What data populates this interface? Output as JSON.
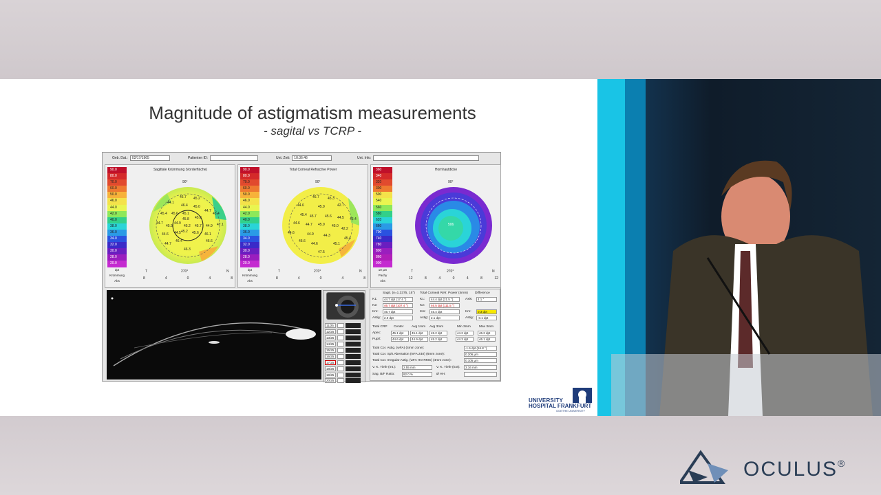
{
  "slide": {
    "title": "Magnitude of astigmatism measurements",
    "subtitle": "- sagital vs TCRP -"
  },
  "pentacam": {
    "header": {
      "dob_label": "Geb. Dat.:",
      "dob_value": "02/17/1965",
      "patient_label": "Patienten ID:",
      "time_label": "Unt. Zeit:",
      "time_value": "10:36:46",
      "info_label": "Unt. Info:"
    },
    "maps": [
      {
        "title": "Sagittale Krümmung (Vorderfläche)",
        "scale": [
          "90.0",
          "80.0",
          "70.0",
          "60.0",
          "50.0",
          "46.0",
          "44.0",
          "42.0",
          "40.0",
          "38.0",
          "36.0",
          "34.0",
          "32.0",
          "30.0",
          "28.0",
          "20.0",
          "10.0"
        ],
        "unit": "dpt",
        "foot1": "Krümmung",
        "foot2": "Abs",
        "values": [
          "46.7",
          "45.2",
          "44.1",
          "45.4",
          "46.4",
          "45.0",
          "44.7",
          "45.6",
          "45.1",
          "43.4",
          "44.7",
          "45.0",
          "45.8",
          "45.5",
          "44.9",
          "47.1",
          "45.2",
          "45.7",
          "44.9",
          "44.6",
          "44.5",
          "46.1",
          "45.2",
          "45.6",
          "46.3",
          "44.7",
          "46.4",
          "46.6"
        ],
        "axis": [
          "8",
          "4",
          "0",
          "4",
          "8"
        ]
      },
      {
        "title": "Total Corneal Refractive Power",
        "scale": [
          "90.0",
          "80.0",
          "70.0",
          "60.0",
          "50.0",
          "46.0",
          "44.0",
          "42.0",
          "40.0",
          "38.0",
          "36.0",
          "34.0",
          "32.0",
          "30.0",
          "28.0",
          "20.0",
          "10.0"
        ],
        "unit": "dpt",
        "foot1": "Krümmung",
        "foot2": "Abs",
        "values": [
          "46.7",
          "45.3",
          "44.6",
          "45.4",
          "45.9",
          "42.7",
          "44.6",
          "45.7",
          "45.6",
          "44.5",
          "43.4",
          "44.7",
          "45.9",
          "44.6",
          "44.9",
          "45.0",
          "42.2",
          "44.3",
          "45.6",
          "44.6",
          "45.1",
          "47.5",
          "45.4"
        ],
        "axis": [
          "8",
          "4",
          "0",
          "4",
          "8"
        ]
      },
      {
        "title": "Hornhautdicke",
        "scale": [
          "360",
          "340",
          "320",
          "300",
          "500",
          "540",
          "560",
          "580",
          "620",
          "660",
          "700",
          "740",
          "780",
          "800",
          "860",
          "900"
        ],
        "unit": "10 µm",
        "foot1": "Pachy",
        "foot2": "Abs",
        "center_value": "506",
        "axis": [
          "12",
          "8",
          "4",
          "0",
          "4",
          "8",
          "12"
        ]
      }
    ],
    "orientation": {
      "top": "90°",
      "bottom": "270°",
      "left": "T",
      "right": "N"
    },
    "thumbnails": [
      "11/25",
      "12/25",
      "13/25",
      "14/25",
      "15/25",
      "16/25",
      "17/25",
      "18/25",
      "19/25",
      "20/25"
    ],
    "data": {
      "col1_head": "Sagit. (n=1.3375, 15°)",
      "col2_head": "Total Corneal Refr. Power (4mm)",
      "col3_head": "Difference",
      "rows": [
        {
          "l": "K1:",
          "a": "44.7 dpt (17.4 °)",
          "l2": "K1:",
          "b": "44.4 dpt (21.5 °)",
          "l3": "Axis:",
          "c": "4.1 °"
        },
        {
          "l": "K2:",
          "a": "46.7 dpt (107.4 °)",
          "l2": "K2:",
          "b": "46.5 dpt (111.5 °)",
          "l3": "",
          "c": ""
        },
        {
          "l": "Km:",
          "a": "45.7 dpt",
          "l2": "Km:",
          "b": "45.4 dpt",
          "l3": "Km:",
          "c": "0.3 dpt"
        },
        {
          "l": "Astig:",
          "a": "2.0 dpt",
          "l2": "Astig:",
          "b": "2.1 dpt",
          "l3": "Astig:",
          "c": "-0.1 dpt"
        }
      ],
      "crp_head": [
        "Total CRP",
        "Center",
        "Avg 1mm",
        "Avg 3mm",
        "Min 3mm",
        "Max 3mm"
      ],
      "crp_rows": [
        {
          "l": "Apex:",
          "v": [
            "45.1 dpt",
            "45.1 dpt",
            "45.2 dpt",
            "44.2 dpt",
            "46.2 dpt"
          ]
        },
        {
          "l": "Pupil:",
          "v": [
            "44.6 dpt",
            "44.9 dpt",
            "45.2 dpt",
            "44.3 dpt",
            "46.1 dpt"
          ]
        }
      ],
      "extra": [
        {
          "l": "Total Cor. Astig. (wFA) (4mm zone):",
          "v": "-1.6 dpt (16.8 °)"
        },
        {
          "l": "Total Cor. Sph.Aberration (wFA Z40) (6mm zone):",
          "v": "0.206 µm"
        },
        {
          "l": "Total Cor. Irregular Astig. (wFA HO RMS) (4mm zone):",
          "v": "0.105 µm"
        }
      ],
      "vk_left_label": "V. K. Tiefe (Int.):",
      "vk_left": "2.55 mm",
      "vk_right_label": "V. K. Tiefe (Ext):",
      "vk_right": "3.16 mm",
      "ratio_label": "Sag. B/F Ratio:",
      "ratio": "82.0 %",
      "hh_label": "Ø HH:"
    }
  },
  "logo": {
    "line1": "UNIVERSITY",
    "line2": "HOSPITAL FRANKFURT",
    "line3": "GOETHE UNIVERSITY"
  },
  "brand": {
    "name": "OCULUS",
    "mark": "®"
  }
}
